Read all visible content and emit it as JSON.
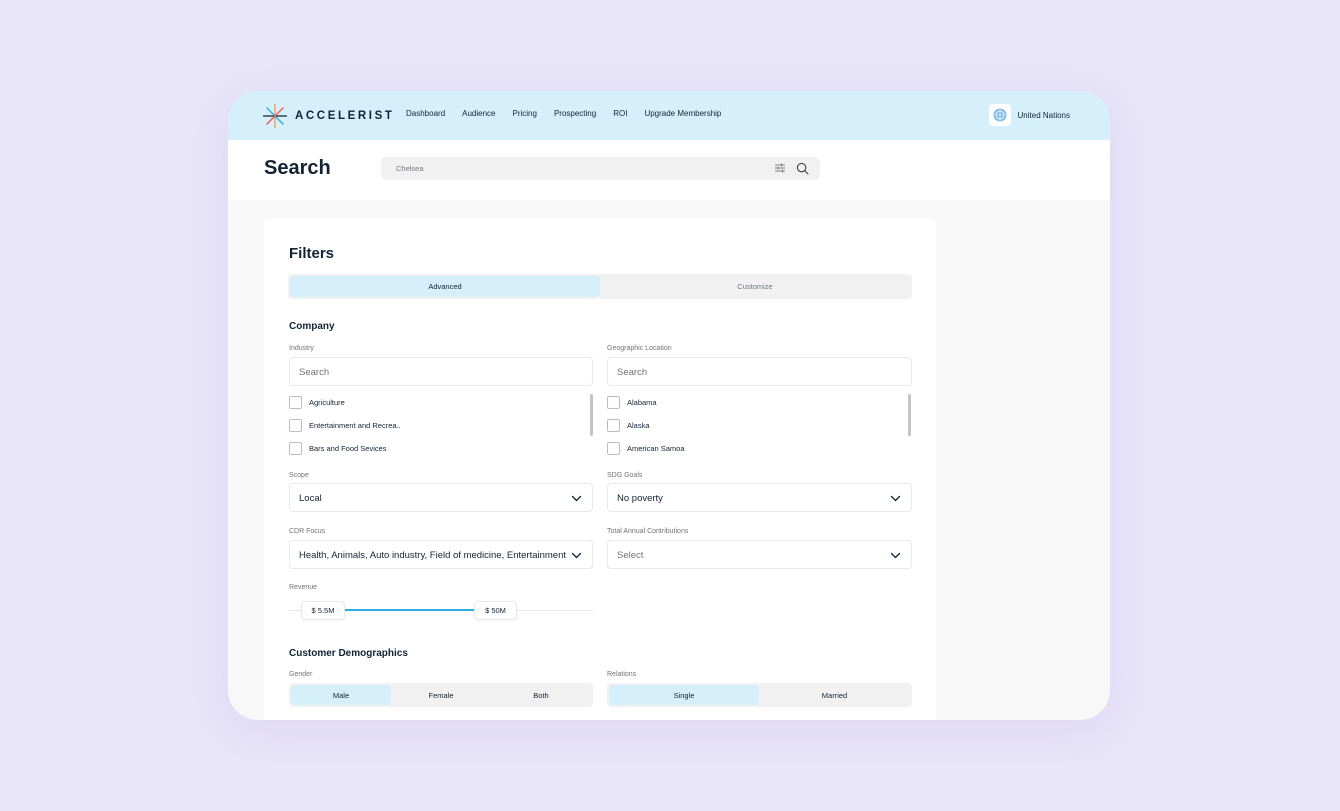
{
  "app": {
    "logo_text": "ACCELERIST"
  },
  "nav": {
    "items": [
      "Dashboard",
      "Audience",
      "Pricing",
      "Prospecting",
      "ROI",
      "Upgrade Membership"
    ]
  },
  "org": {
    "name": "United Nations",
    "avatar_icon": "un-emblem-icon"
  },
  "header": {
    "title": "Search",
    "search_value": "Chelsea"
  },
  "filters": {
    "title": "Filters",
    "tabs": [
      {
        "label": "Advanced",
        "active": true
      },
      {
        "label": "Customize",
        "active": false
      }
    ],
    "company": {
      "title": "Company",
      "industry": {
        "label": "Industry",
        "placeholder": "Search",
        "options": [
          "Agriculture",
          "Entertainment and Recrea..",
          "Bars and Food Sevices"
        ]
      },
      "location": {
        "label": "Geographic Location",
        "placeholder": "Search",
        "options": [
          "Alabama",
          "Alaska",
          "American Samoa"
        ]
      },
      "scope": {
        "label": "Scope",
        "value": "Local"
      },
      "sdg": {
        "label": "SDG Goals",
        "value": "No poverty"
      },
      "cdr": {
        "label": "CDR Focus",
        "value": "Health, Animals, Auto industry, Field of medicine, Entertainment"
      },
      "contributions": {
        "label": "Total Annual Contributions",
        "placeholder": "Select"
      },
      "revenue": {
        "label": "Revenue",
        "min_label": "$ 5.5M",
        "max_label": "$ 50M"
      }
    },
    "demographics": {
      "title": "Customer Demographics",
      "gender": {
        "label": "Gender",
        "options": [
          "Male",
          "Female",
          "Both"
        ],
        "selected": "Male"
      },
      "relations": {
        "label": "Relations",
        "options": [
          "Single",
          "Married"
        ],
        "selected": "Single"
      }
    }
  },
  "colors": {
    "accent": "#d5f0fb",
    "slider": "#2baee0",
    "background": "#e8e4f9",
    "text": "#122434"
  }
}
